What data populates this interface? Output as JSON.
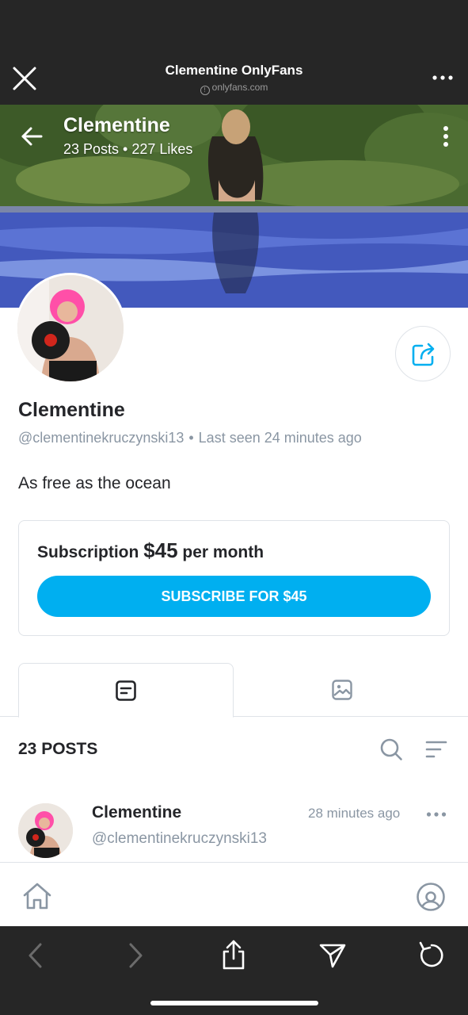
{
  "browser": {
    "title": "Clementine OnlyFans",
    "domain": "onlyfans.com",
    "info_glyph": "!"
  },
  "banner": {
    "name": "Clementine",
    "posts": "23 Posts",
    "likes": "227 Likes",
    "separator": "•"
  },
  "profile": {
    "name": "Clementine",
    "handle": "@clementinekruczynski13",
    "separator": "•",
    "last_seen": "Last seen 24 minutes ago",
    "bio": "As free as the ocean"
  },
  "subscription": {
    "label": "Subscription",
    "price": "$45",
    "period": "per month",
    "button_label": "SUBSCRIBE FOR $45"
  },
  "tabs": [
    {
      "icon": "posts-icon",
      "active": true
    },
    {
      "icon": "media-icon",
      "active": false
    }
  ],
  "posts_section": {
    "count_label": "23 POSTS"
  },
  "post": {
    "author": "Clementine",
    "handle": "@clementinekruczynski13",
    "time": "28 minutes ago"
  },
  "colors": {
    "accent": "#00aff0",
    "text": "#242529",
    "muted": "#8a96a3",
    "border": "#dfe3e8",
    "chrome": "#262626"
  },
  "icons": [
    "close-icon",
    "more-horizontal-icon",
    "back-arrow-icon",
    "kebab-icon",
    "share-icon",
    "posts-icon",
    "media-icon",
    "search-icon",
    "sort-icon",
    "home-icon",
    "user-icon",
    "browser-back-icon",
    "browser-forward-icon",
    "upload-icon",
    "send-icon",
    "reload-icon"
  ]
}
